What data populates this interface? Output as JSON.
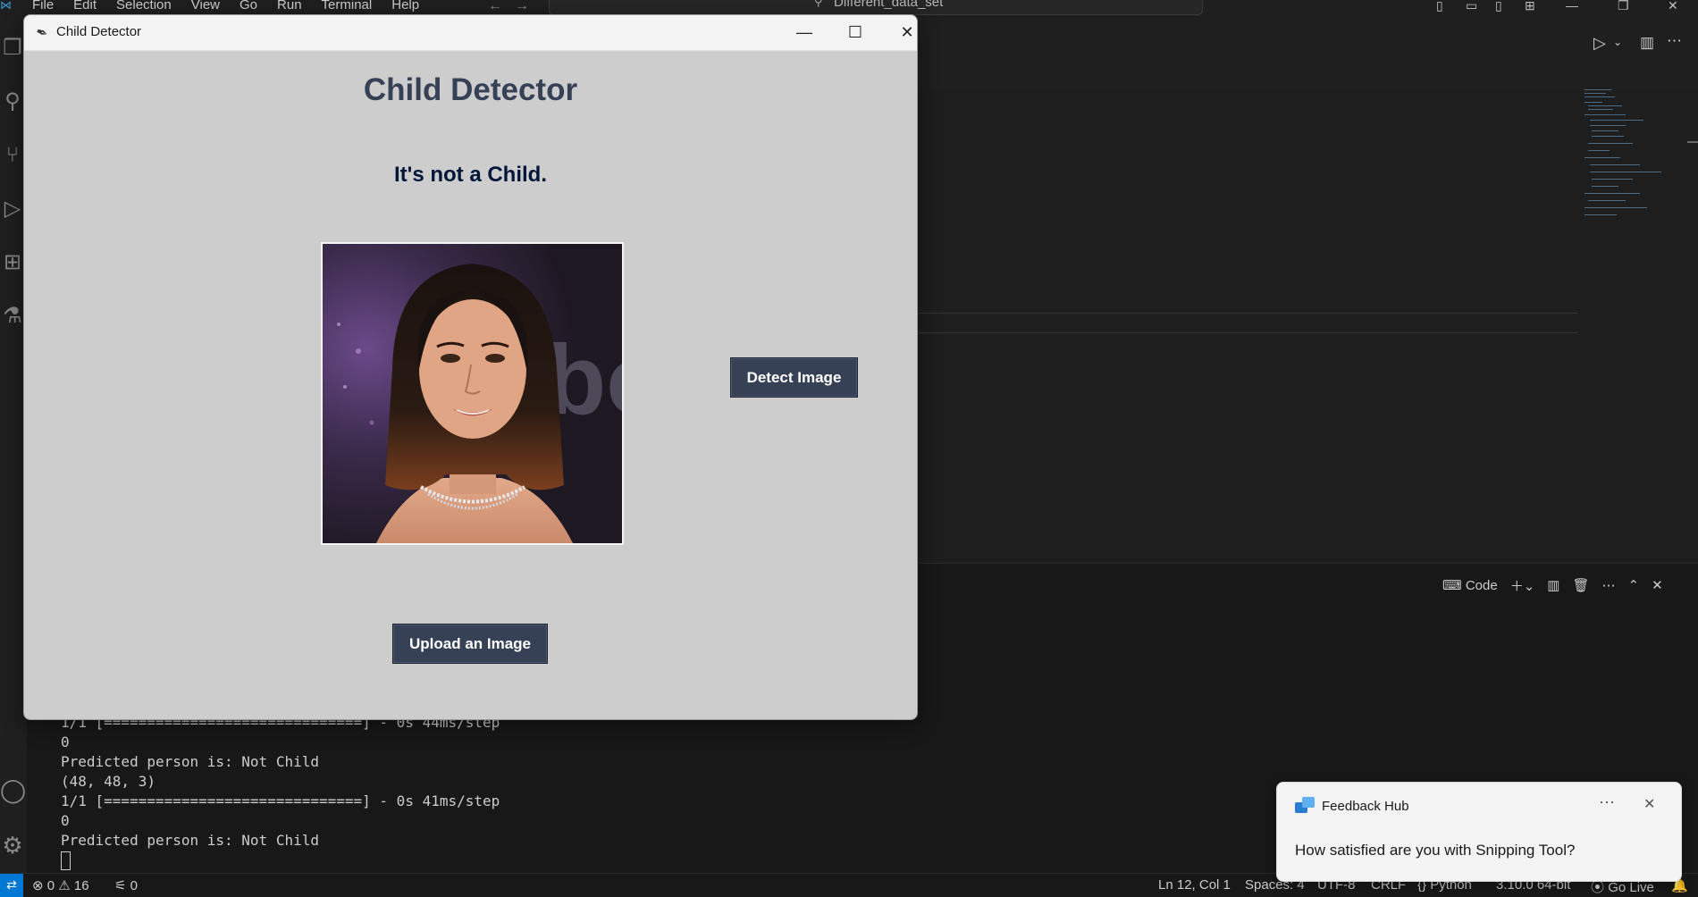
{
  "vscode": {
    "menu": [
      "File",
      "Edit",
      "Selection",
      "View",
      "Go",
      "Run",
      "Terminal",
      "Help"
    ],
    "search_text": "Different_data_set",
    "panel_profile_label": "Code",
    "terminal_lines": [
      "1/1 [==============================] - 0s 44ms/step",
      "0",
      "Predicted person is: Not Child",
      "(48, 48, 3)",
      "1/1 [==============================] - 0s 41ms/step",
      "0",
      "Predicted person is: Not Child"
    ],
    "status": {
      "errors": "0",
      "warnings": "16",
      "ports": "0",
      "position": "Ln 12, Col 1",
      "spaces": "Spaces: 4",
      "encoding": "UTF-8",
      "eol": "CRLF",
      "language": "Python",
      "interpreter": "3.10.0 64-bit",
      "golive": "Go Live"
    }
  },
  "app": {
    "window_title": "Child Detector",
    "heading": "Child Detector",
    "result_text": "It's not a Child.",
    "detect_button": "Detect Image",
    "upload_button": "Upload an Image"
  },
  "toast": {
    "app_name": "Feedback Hub",
    "message": "How satisfied are you with Snipping Tool?"
  },
  "colors": {
    "app_bg": "#cdcdcd",
    "heading": "#364156",
    "result": "#011638",
    "button_bg": "#364156",
    "vscode_accent": "#0078d4"
  }
}
